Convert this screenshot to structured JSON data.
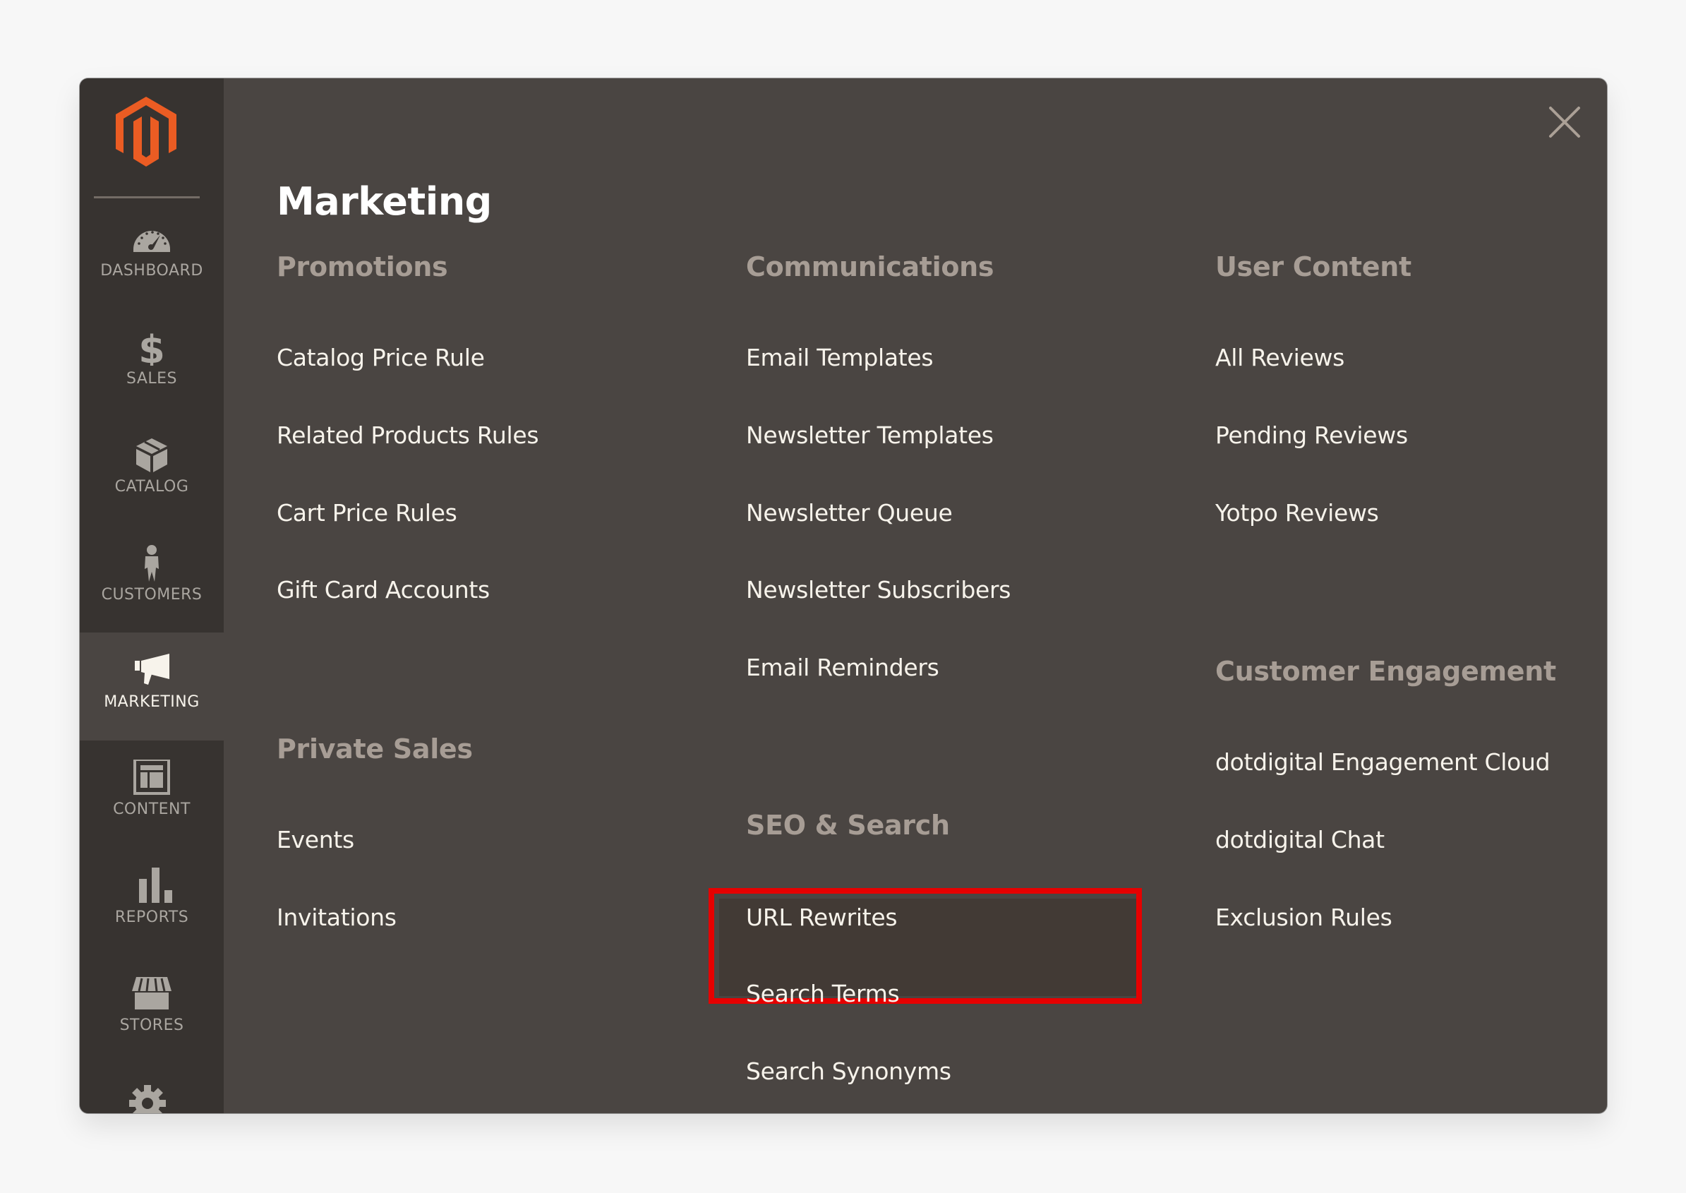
{
  "sidebar": {
    "logo": "magento-logo",
    "items": [
      {
        "label": "Dashboard",
        "icon": "dashboard-icon",
        "active": false
      },
      {
        "label": "Sales",
        "icon": "dollar-icon",
        "active": false
      },
      {
        "label": "Catalog",
        "icon": "box-icon",
        "active": false
      },
      {
        "label": "Customers",
        "icon": "person-icon",
        "active": false
      },
      {
        "label": "Marketing",
        "icon": "megaphone-icon",
        "active": true
      },
      {
        "label": "Content",
        "icon": "layout-icon",
        "active": false
      },
      {
        "label": "Reports",
        "icon": "bar-chart-icon",
        "active": false
      },
      {
        "label": "Stores",
        "icon": "storefront-icon",
        "active": false
      }
    ],
    "partial_item_icon": "gear-icon"
  },
  "flyout": {
    "title": "Marketing",
    "close_icon": "close-icon",
    "sections": [
      {
        "heading": "Promotions",
        "links": [
          "Catalog Price Rule",
          "Related Products Rules",
          "Cart Price Rules",
          "Gift Card Accounts"
        ]
      },
      {
        "heading": "Private Sales",
        "links": [
          "Events",
          "Invitations"
        ]
      },
      {
        "heading": "Communications",
        "links": [
          "Email Templates",
          "Newsletter Templates",
          "Newsletter Queue",
          "Newsletter Subscribers",
          "Email Reminders"
        ]
      },
      {
        "heading": "SEO & Search",
        "links": [
          "URL Rewrites",
          "Search Terms",
          "Search Synonyms"
        ]
      },
      {
        "heading": "User Content",
        "links": [
          "All Reviews",
          "Pending Reviews",
          "Yotpo Reviews"
        ]
      },
      {
        "heading": "Customer Engagement",
        "links": [
          "dotdigital Engagement Cloud",
          "dotdigital Chat",
          "Exclusion Rules"
        ]
      }
    ],
    "highlighted_link": "URL Rewrites"
  },
  "colors": {
    "brand_orange": "#eb5c23",
    "sidebar_bg": "#373330",
    "panel_bg": "#4a4542",
    "heading": "#a79d95",
    "link": "#f7f3eb",
    "highlight_outline": "#e60000"
  }
}
